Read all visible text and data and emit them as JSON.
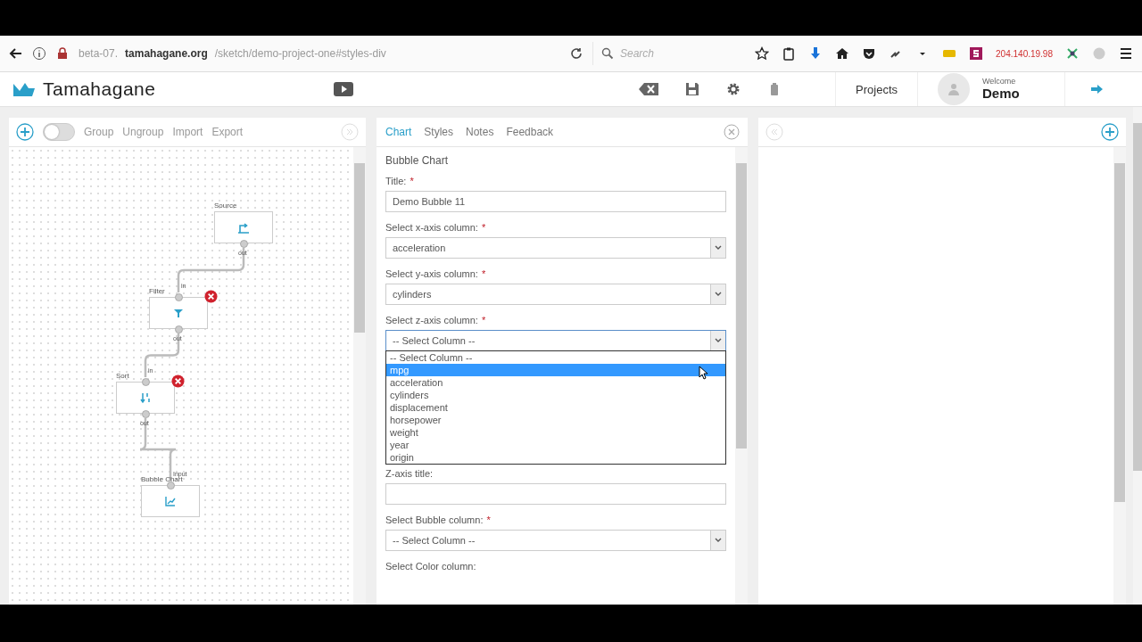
{
  "browser": {
    "url": "beta-07.**tamahagane.org**/sketch/demo-project-one#styles-div",
    "search_placeholder": "Search",
    "ip": "204.140.19.98"
  },
  "header": {
    "brand": "Tamahagane",
    "nav": "Projects",
    "welcome": "Welcome",
    "user": "Demo"
  },
  "canvas_toolbar": {
    "toggle_on": false,
    "actions": [
      "Group",
      "Ungroup",
      "Import",
      "Export"
    ]
  },
  "canvas": {
    "nodes": [
      {
        "label": "Source",
        "kind": "source",
        "removable": false,
        "ports": [
          {
            "kind": "out",
            "label": "out"
          }
        ]
      },
      {
        "label": "Filter",
        "kind": "filter",
        "removable": true,
        "ports": [
          {
            "kind": "in",
            "label": "in"
          },
          {
            "kind": "out",
            "label": "out"
          }
        ]
      },
      {
        "label": "Sort",
        "kind": "sort",
        "removable": true,
        "ports": [
          {
            "kind": "in",
            "label": "in"
          },
          {
            "kind": "out",
            "label": "out"
          }
        ]
      },
      {
        "label": "Bubble Chart",
        "kind": "bubble",
        "removable": false,
        "ports": [
          {
            "kind": "in",
            "label": "Input"
          }
        ]
      }
    ]
  },
  "tabs": [
    {
      "label": "Chart",
      "selected": true
    },
    {
      "label": "Styles",
      "selected": false
    },
    {
      "label": "Notes",
      "selected": false
    },
    {
      "label": "Feedback",
      "selected": false
    }
  ],
  "form": {
    "heading": "Bubble Chart",
    "fields": [
      {
        "kind": "text",
        "label": "Title:",
        "required_mark": "*",
        "value": "Demo Bubble 11"
      },
      {
        "kind": "select",
        "label": "Select x-axis column:",
        "required_mark": "*",
        "value": "acceleration",
        "open": false
      },
      {
        "kind": "select",
        "label": "Select y-axis column:",
        "required_mark": "*",
        "value": "cylinders",
        "open": false
      },
      {
        "kind": "select",
        "label": "Select z-axis column:",
        "required_mark": "*",
        "value": "-- Select Column --",
        "open": true,
        "options": [
          {
            "label": "-- Select Column --",
            "highlighted": false
          },
          {
            "label": "mpg",
            "highlighted": true
          },
          {
            "label": "acceleration",
            "highlighted": false
          },
          {
            "label": "cylinders",
            "highlighted": false
          },
          {
            "label": "displacement",
            "highlighted": false
          },
          {
            "label": "horsepower",
            "highlighted": false
          },
          {
            "label": "weight",
            "highlighted": false
          },
          {
            "label": "year",
            "highlighted": false
          },
          {
            "label": "origin",
            "highlighted": false
          }
        ]
      },
      {
        "kind": "text",
        "label": "Z-axis title:"
      },
      {
        "kind": "select",
        "label": "Select Bubble column:",
        "required_mark": "*",
        "value": "-- Select Column --",
        "open": false
      },
      {
        "kind": "label",
        "label": "Select Color column:"
      }
    ]
  }
}
